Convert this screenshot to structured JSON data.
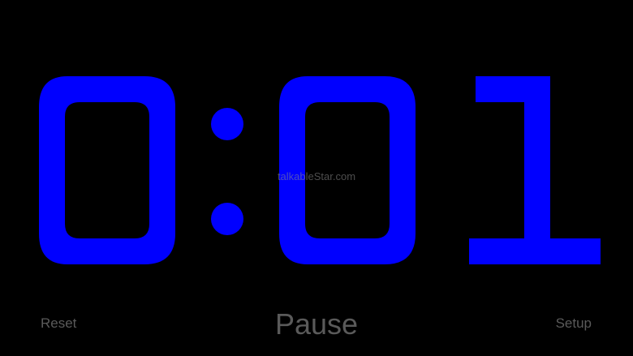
{
  "timer": {
    "display": "0:01",
    "minutes": "0",
    "separator": ":",
    "seconds_tens": "0",
    "seconds_ones": "1",
    "color": "#0000ff"
  },
  "watermark": {
    "text": "talkableStar.com"
  },
  "controls": {
    "reset_label": "Reset",
    "pause_label": "Pause",
    "setup_label": "Setup",
    "text_color": "#5a5a5a"
  },
  "background_color": "#000000"
}
